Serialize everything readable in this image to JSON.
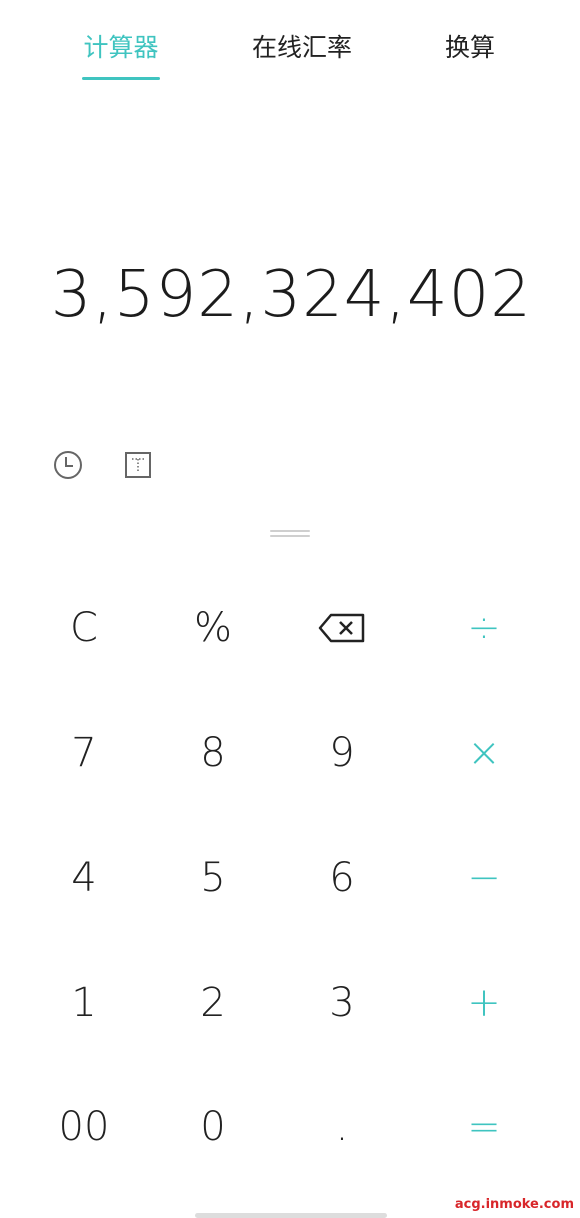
{
  "tabs": [
    {
      "label": "计算器",
      "active": true
    },
    {
      "label": "在线汇率",
      "active": false
    },
    {
      "label": "换算",
      "active": false
    }
  ],
  "display": {
    "value": "3,592,324,402"
  },
  "tools": {
    "history_icon": "clock-icon",
    "mode_icon": "expand-icon"
  },
  "keys": {
    "clear": "C",
    "percent": "%",
    "backspace_icon": "backspace-icon",
    "divide": "÷",
    "seven": "7",
    "eight": "8",
    "nine": "9",
    "multiply": "×",
    "four": "4",
    "five": "5",
    "six": "6",
    "minus": "−",
    "one": "1",
    "two": "2",
    "three": "3",
    "plus": "+",
    "double_zero": "00",
    "zero": "0",
    "dot": ".",
    "equals": "="
  },
  "watermark": "acg.inmoke.com",
  "colors": {
    "accent": "#3fc4c0",
    "text": "#222222"
  }
}
